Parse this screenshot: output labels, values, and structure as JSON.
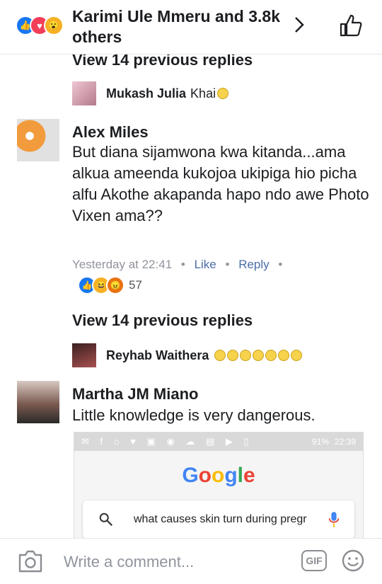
{
  "header": {
    "title": "Karimi Ule Mmeru and 3.8k others",
    "reaction_colors": [
      "#1877f2",
      "#f33e58",
      "#f7b125"
    ]
  },
  "thread": {
    "view_more_1": "View 14 previous replies",
    "reply_1": {
      "name": "Mukash Julia",
      "text": "Khai"
    },
    "comment_1": {
      "name": "Alex Miles",
      "body": "But diana sijamwona kwa kitanda...ama alkua ameenda kukojoa ukipiga hio picha alfu Akothe akapanda hapo ndo awe Photo Vixen ama??",
      "time": "Yesterday at 22:41",
      "like": "Like",
      "reply": "Reply",
      "reaction_count": "57"
    },
    "view_more_2": "View 14 previous replies",
    "reply_2": {
      "name": "Reyhab Waithera",
      "emoji_count": 7
    },
    "comment_2": {
      "name": "Martha JM Miano",
      "body": "Little knowledge is very dangerous.",
      "attachment": {
        "battery": "91%",
        "time": "22:39",
        "search_query": "what causes skin turn during pregr"
      }
    }
  },
  "composer": {
    "placeholder": "Write a comment...",
    "gif_label": "GIF"
  }
}
